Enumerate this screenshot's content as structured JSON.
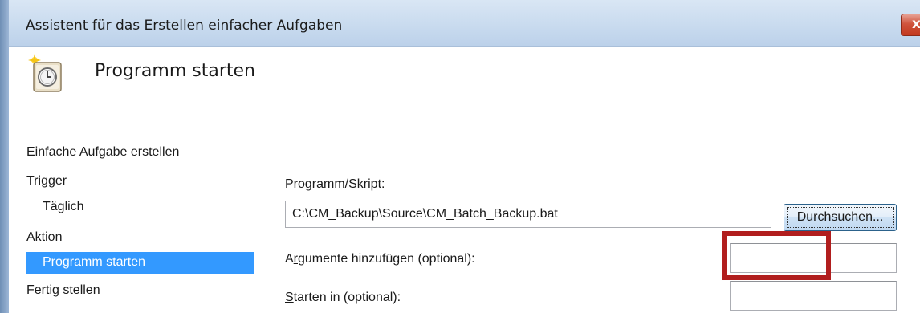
{
  "window": {
    "title": "Assistent für das Erstellen einfacher Aufgaben",
    "close_glyph": "x",
    "icon": "scheduled-task-clock-icon"
  },
  "header": {
    "title": "Programm starten"
  },
  "nav": {
    "items": [
      {
        "label": "Einfache Aufgabe erstellen"
      },
      {
        "label": "Trigger"
      },
      {
        "label": "Täglich"
      },
      {
        "label": "Aktion"
      },
      {
        "label": "Programm starten",
        "selected": true
      },
      {
        "label": "Fertig stellen"
      }
    ]
  },
  "form": {
    "program_label": "Programm/Skript:",
    "program_value": "C:\\CM_Backup\\Source\\CM_Batch_Backup.bat",
    "browse_label": "Durchsuchen...",
    "arguments_label": "Argumente hinzufügen (optional):",
    "arguments_value": "",
    "start_in_label": "Starten in (optional):",
    "start_in_value": ""
  },
  "colors": {
    "selection": "#3399ff",
    "highlight_frame": "#b11e1e",
    "titlebar": "#c9dbef"
  }
}
